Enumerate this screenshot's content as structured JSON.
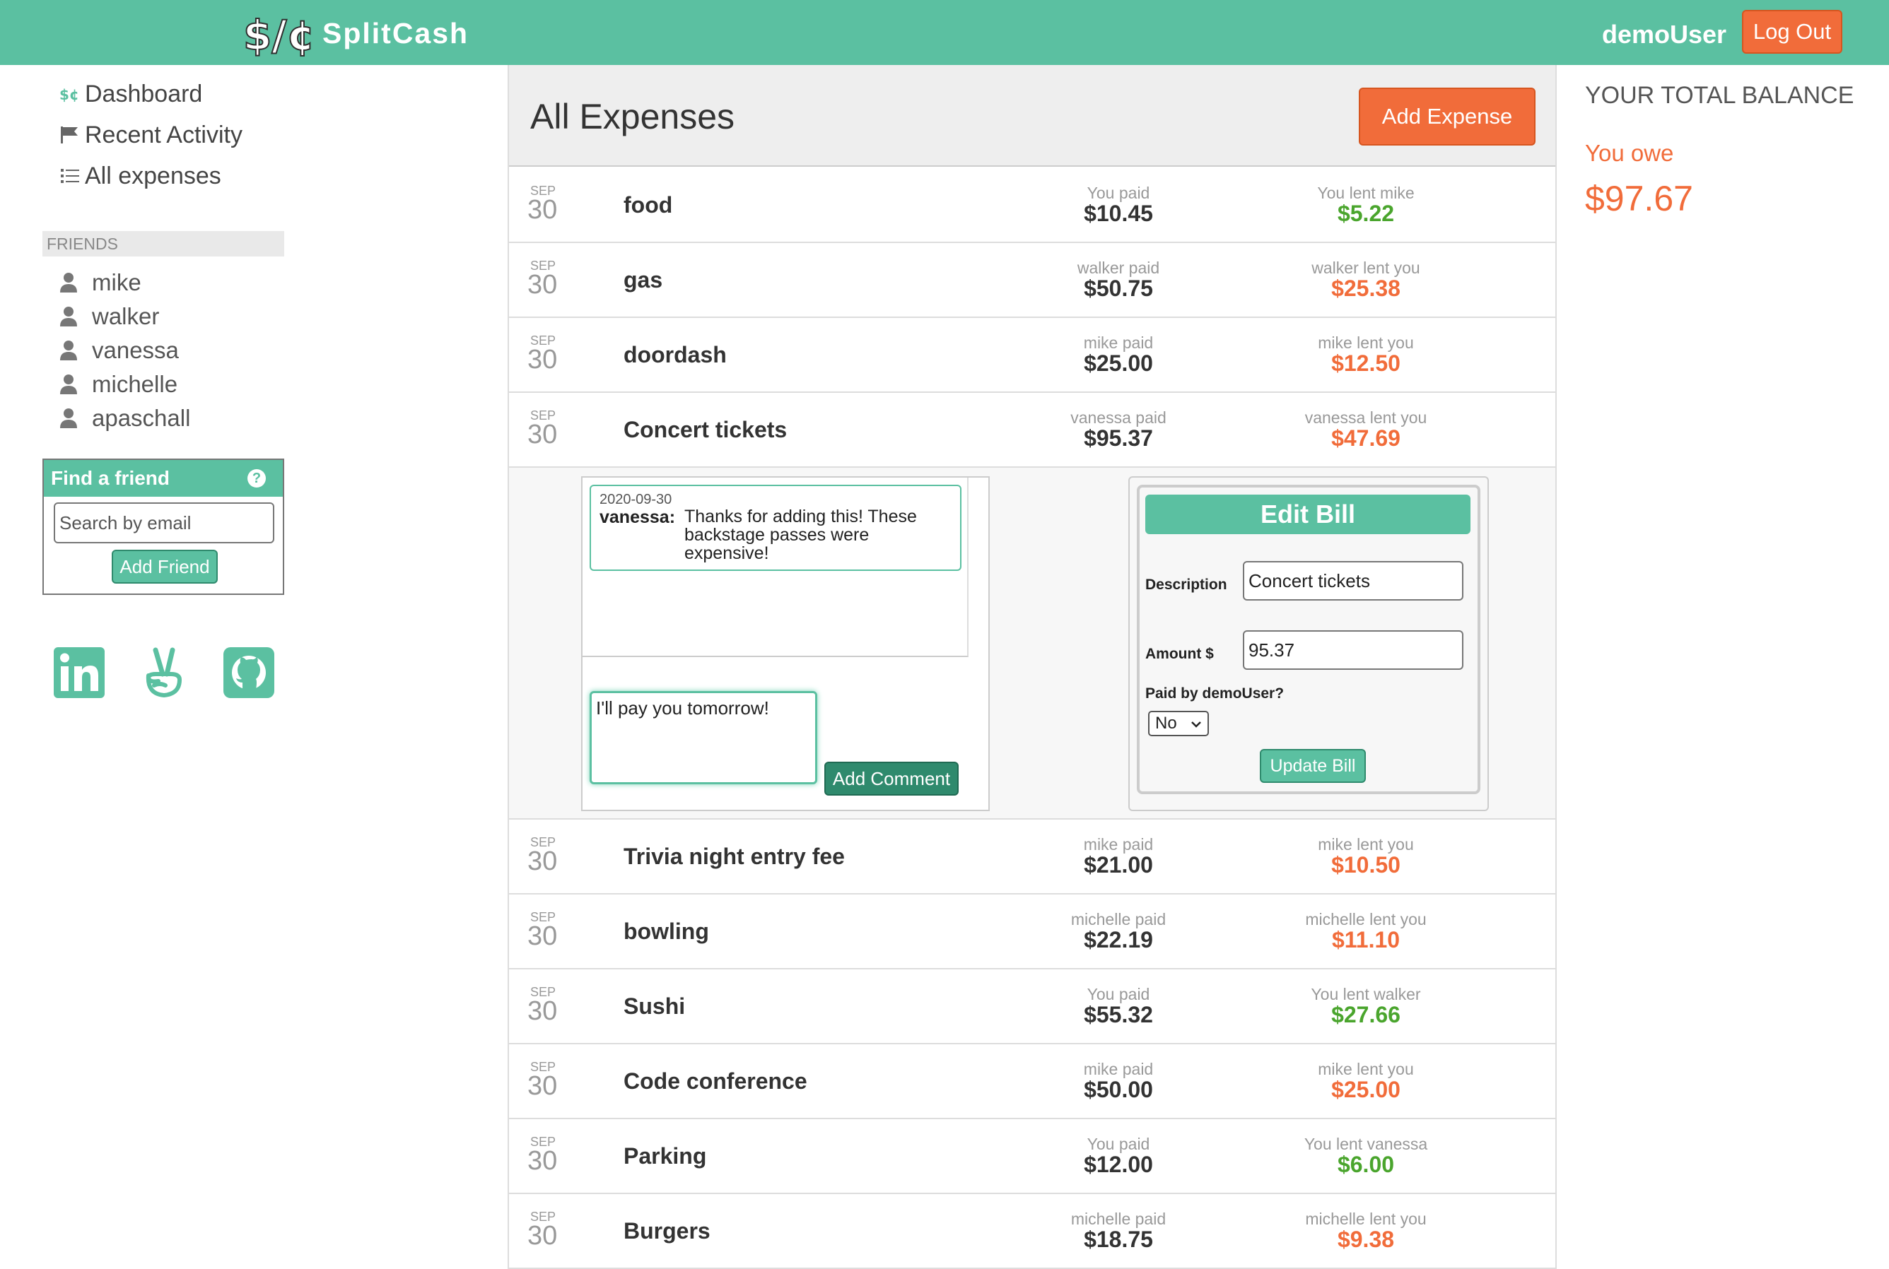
{
  "header": {
    "brand": "SplitCash",
    "logo_text": "$/¢",
    "username": "demoUser",
    "logout_label": "Log Out"
  },
  "nav": [
    {
      "label": "Dashboard",
      "icon": "money-icon"
    },
    {
      "label": "Recent Activity",
      "icon": "flag-icon"
    },
    {
      "label": "All expenses",
      "icon": "list-icon"
    }
  ],
  "friends": {
    "header": "FRIENDS",
    "list": [
      "mike",
      "walker",
      "vanessa",
      "michelle",
      "apaschall"
    ]
  },
  "find_friend": {
    "title": "Find a friend",
    "help": "?",
    "placeholder": "Search by email",
    "button": "Add Friend"
  },
  "social": [
    "linkedin-icon",
    "angellist-icon",
    "github-icon"
  ],
  "main": {
    "title": "All Expenses",
    "add_button": "Add Expense"
  },
  "expenses": [
    {
      "month": "SEP",
      "day": "30",
      "desc": "food",
      "paid_label": "You paid",
      "paid": "$10.45",
      "lent_label": "You lent mike",
      "lent": "$5.22",
      "lent_type": "pos"
    },
    {
      "month": "SEP",
      "day": "30",
      "desc": "gas",
      "paid_label": "walker paid",
      "paid": "$50.75",
      "lent_label": "walker lent you",
      "lent": "$25.38",
      "lent_type": "neg"
    },
    {
      "month": "SEP",
      "day": "30",
      "desc": "doordash",
      "paid_label": "mike paid",
      "paid": "$25.00",
      "lent_label": "mike lent you",
      "lent": "$12.50",
      "lent_type": "neg"
    },
    {
      "month": "SEP",
      "day": "30",
      "desc": "Concert tickets",
      "paid_label": "vanessa paid",
      "paid": "$95.37",
      "lent_label": "vanessa lent you",
      "lent": "$47.69",
      "lent_type": "neg"
    },
    {
      "month": "SEP",
      "day": "30",
      "desc": "Trivia night entry fee",
      "paid_label": "mike paid",
      "paid": "$21.00",
      "lent_label": "mike lent you",
      "lent": "$10.50",
      "lent_type": "neg"
    },
    {
      "month": "SEP",
      "day": "30",
      "desc": "bowling",
      "paid_label": "michelle paid",
      "paid": "$22.19",
      "lent_label": "michelle lent you",
      "lent": "$11.10",
      "lent_type": "neg"
    },
    {
      "month": "SEP",
      "day": "30",
      "desc": "Sushi",
      "paid_label": "You paid",
      "paid": "$55.32",
      "lent_label": "You lent walker",
      "lent": "$27.66",
      "lent_type": "pos"
    },
    {
      "month": "SEP",
      "day": "30",
      "desc": "Code conference",
      "paid_label": "mike paid",
      "paid": "$50.00",
      "lent_label": "mike lent you",
      "lent": "$25.00",
      "lent_type": "neg"
    },
    {
      "month": "SEP",
      "day": "30",
      "desc": "Parking",
      "paid_label": "You paid",
      "paid": "$12.00",
      "lent_label": "You lent vanessa",
      "lent": "$6.00",
      "lent_type": "pos"
    },
    {
      "month": "SEP",
      "day": "30",
      "desc": "Burgers",
      "paid_label": "michelle paid",
      "paid": "$18.75",
      "lent_label": "michelle lent you",
      "lent": "$9.38",
      "lent_type": "neg"
    }
  ],
  "detail": {
    "comment": {
      "date": "2020-09-30",
      "author": "vanessa:",
      "text": "Thanks for adding this! These backstage passes were expensive!"
    },
    "comment_input_value": "I'll pay you tomorrow!",
    "add_comment_label": "Add Comment",
    "edit_bill": {
      "title": "Edit Bill",
      "description_label": "Description",
      "description_value": "Concert tickets",
      "amount_label": "Amount $",
      "amount_value": "95.37",
      "paid_by_label": "Paid by demoUser?",
      "paid_by_value": "No",
      "update_label": "Update Bill"
    }
  },
  "balance": {
    "title": "YOUR TOTAL BALANCE",
    "status": "You owe",
    "amount": "$97.67"
  },
  "colors": {
    "brand": "#5bc0a1",
    "accent": "#f16c3a",
    "positive": "#4aa52d",
    "negative": "#f16c3a"
  }
}
